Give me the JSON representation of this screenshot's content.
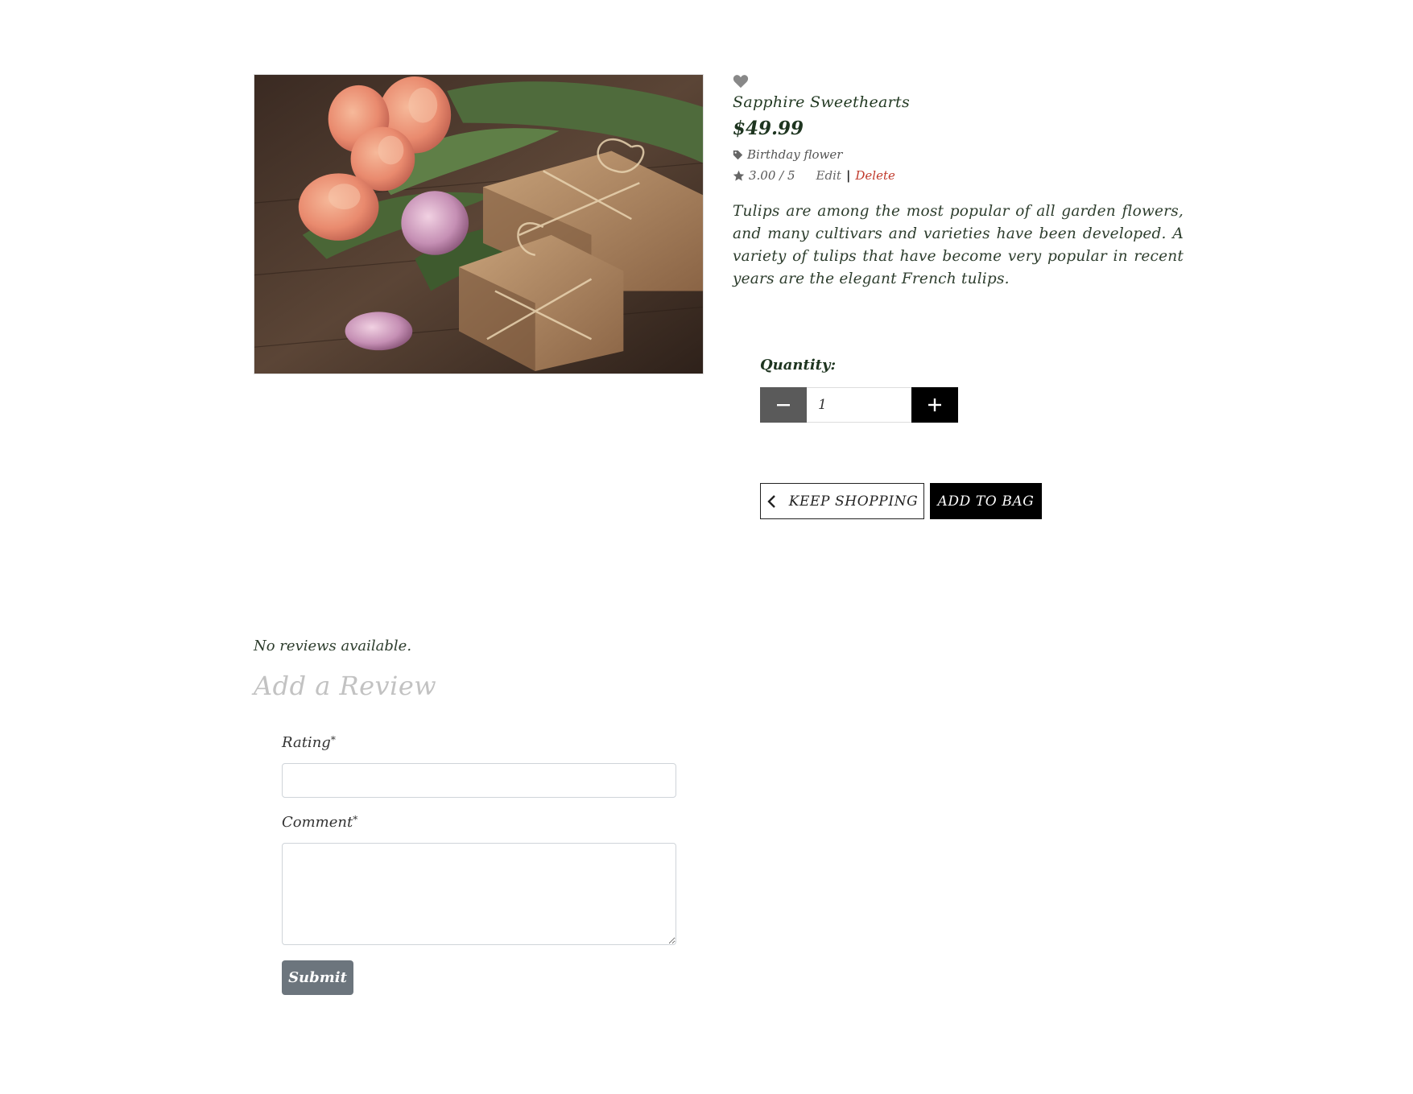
{
  "product": {
    "name": "Sapphire Sweethearts",
    "price": "$49.99",
    "category": "Birthday flower",
    "rating": "3.00 / 5",
    "edit_label": "Edit",
    "separator": "|",
    "delete_label": "Delete",
    "description": "Tulips are among the most popular of all garden flowers, and many cultivars and varieties have been developed. A variety of tulips that have become very popular in recent years are the elegant French tulips.",
    "image_alt": "Tulips with gift boxes"
  },
  "icons": {
    "wishlist": "heart-icon",
    "category": "tag-icon",
    "rating": "star-icon",
    "back": "chevron-left-icon",
    "decrement": "minus-icon",
    "increment": "plus-icon"
  },
  "quantity": {
    "label": "Quantity:",
    "value": "1"
  },
  "actions": {
    "keep_shopping": "KEEP SHOPPING",
    "add_to_bag": "ADD TO BAG"
  },
  "reviews": {
    "empty_text": "No reviews available.",
    "heading": "Add a Review",
    "rating_label": "Rating",
    "comment_label": "Comment",
    "required_mark": "*",
    "submit_label": "Submit"
  },
  "colors": {
    "price": "#1e3520",
    "delete": "#c0392b",
    "dark_button": "#000000",
    "minus_button": "#5a5a5a",
    "submit_button": "#6c757d"
  }
}
